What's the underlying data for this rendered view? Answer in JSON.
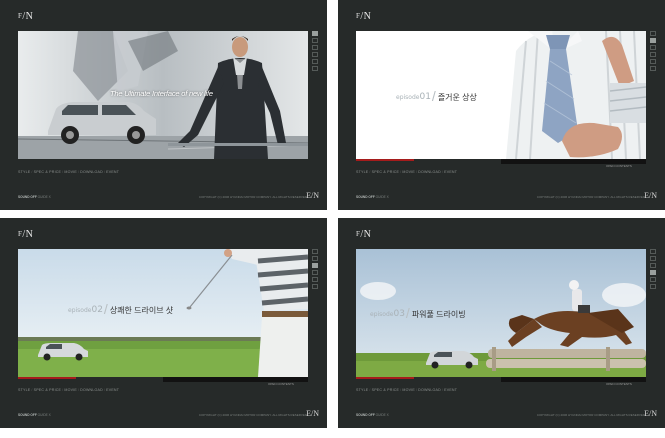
{
  "logo": {
    "prefix": "F",
    "main": "/N"
  },
  "footer_nav": [
    "STYLE",
    "SPEC & PRICE",
    "MOVIE",
    "DOWNLOAD",
    "EVENT"
  ],
  "footer_sep": "/",
  "bottom": {
    "left_strong": "SOUND OFF",
    "left_rest": "GUIDE X",
    "copyright": "COPYRIGHT (C) 2006 HYUNDAI MOTOR COMPANY. ALL RIGHTS RESERVED",
    "logo": "E/N"
  },
  "panels": [
    {
      "tagline": "The Ultimate Interface of new life",
      "side_active": 0
    },
    {
      "episode_label": "episode",
      "episode_num": "01",
      "sub": "",
      "title": "즐거운 상상",
      "open_label": "OPEN CONTENTS",
      "side_active": 1
    },
    {
      "episode_label": "episode",
      "episode_num": "02",
      "sub": "",
      "title": "상쾌한 드라이브 샷",
      "open_label": "OPEN CONTENTS",
      "side_active": 2
    },
    {
      "episode_label": "episode",
      "episode_num": "03",
      "sub": "",
      "title": "파워풀 드라이빙",
      "open_label": "OPEN CONTENTS",
      "side_active": 3
    }
  ],
  "colors": {
    "panel_bg": "#262a29",
    "accent_red": "#a51c1c",
    "bar_black": "#121212"
  }
}
